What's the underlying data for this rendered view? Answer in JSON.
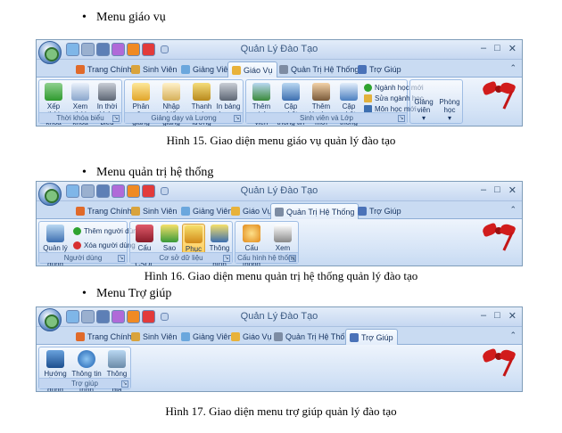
{
  "sections": [
    {
      "heading": "Menu giáo vụ",
      "window_title": "Quản Lý Đào Tạo",
      "tabs": [
        "Trang Chính",
        "Sinh Viên",
        "Giảng Viên",
        "Giáo Vụ",
        "Quản Trị Hệ Thống",
        "Trợ Giúp"
      ],
      "active_tab": "Giáo Vụ",
      "groups": [
        {
          "label": "Thời khóa biểu",
          "buttons": [
            "Xếp thời khóa biểu",
            "Xem thời khóa biểu",
            "In thời khóa biểu"
          ]
        },
        {
          "label": "Giảng dạy và Lương",
          "buttons": [
            "Phân công giảng dạy",
            "Nhập phiếu giảng dạy",
            "Thanh toán lương",
            "In bảng lương"
          ]
        },
        {
          "label": "Sinh viên và Lớp",
          "buttons": [
            "Thêm sinh viên mới",
            "Cập nhật thông tin SV",
            "Thêm lớp học mới",
            "Cập nhật thông tin lớp"
          ],
          "small_buttons": [
            "Ngành học mới",
            "Sửa ngành học",
            "Môn học mới"
          ]
        },
        {
          "label": "",
          "dropdowns": [
            "Giảng viên",
            "Phòng học"
          ]
        }
      ],
      "caption": "Hình 15. Giao diện menu giáo vụ quản lý đào tạo"
    },
    {
      "heading": "Menu quản trị hệ thống",
      "window_title": "Quản Lý Đào Tạo",
      "tabs": [
        "Trang Chính",
        "Sinh Viên",
        "Giảng Viên",
        "Giáo Vụ",
        "Quản Trị Hệ Thống",
        "Trợ Giúp"
      ],
      "active_tab": "Quản Trị Hệ Thống",
      "groups": [
        {
          "label": "Người dùng",
          "buttons": [
            "Quản lý người dùng"
          ],
          "small_buttons": [
            "Thêm người dùng",
            "Xóa người dùng"
          ]
        },
        {
          "label": "Cơ sở dữ liệu",
          "buttons": [
            "Cấu hình CSDL",
            "Sao lưu",
            "Phục hồi",
            "Thông tin cấu hình"
          ]
        },
        {
          "label": "Cấu hình hệ thống",
          "buttons": [
            "Cấu hình hệ thống",
            "Xem nhật ký"
          ]
        }
      ],
      "caption": "Hình 16. Giao diện menu quản trị hệ thống quản lý đào tạo"
    },
    {
      "heading": "Menu Trợ giúp",
      "window_title": "Quản Lý Đào Tạo",
      "tabs": [
        "Trang Chính",
        "Sinh Viên",
        "Giảng Viên",
        "Giáo Vụ",
        "Quản Trị Hệ Thống",
        "Trợ Giúp"
      ],
      "active_tab": "Trợ Giúp",
      "groups": [
        {
          "label": "Trợ giúp",
          "buttons": [
            "Hướng dẫn sử dụng",
            "Thông tin chương trình",
            "Thông tin tác giả"
          ]
        }
      ],
      "caption": "Hình 17. Giao diện menu trợ giúp quản lý đào tạo"
    }
  ],
  "colors": {
    "tab_text": "#15325f",
    "ribbon_bg": "#d4e3f6",
    "group_border": "#9fbde4",
    "pressed": "#ffc94a"
  }
}
